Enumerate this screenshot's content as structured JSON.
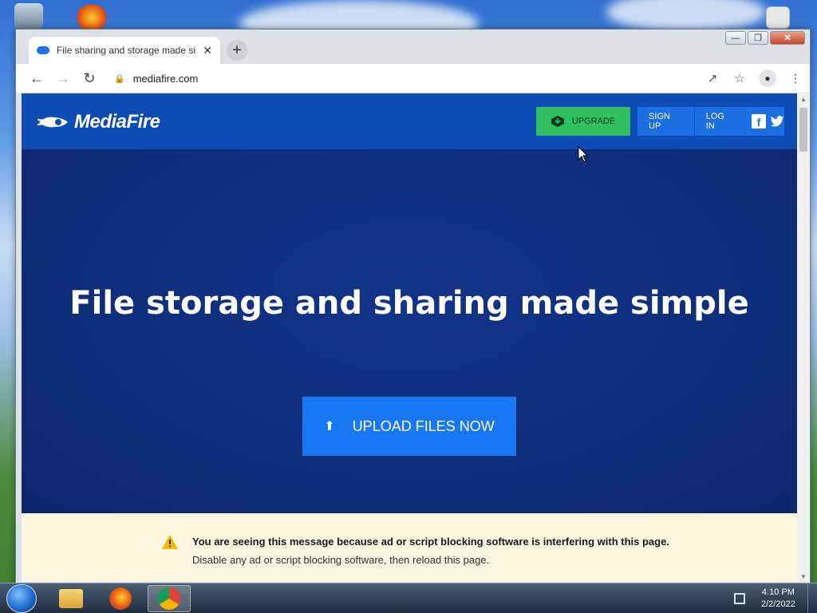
{
  "browser": {
    "tab_title": "File sharing and storage made simple",
    "url": "mediafire.com"
  },
  "header": {
    "logo_text": "MediaFire",
    "upgrade_label": "UPGRADE",
    "signup_label": "SIGN UP",
    "login_label": "LOG IN"
  },
  "hero": {
    "title": "File storage and sharing made simple",
    "upload_label": "UPLOAD FILES NOW"
  },
  "notice": {
    "title": "You are seeing this message because ad or script blocking software is interfering with this page.",
    "text": "Disable any ad or script blocking software, then reload this page."
  },
  "taskbar": {
    "time": "4:10 PM",
    "date": "2/2/2022"
  },
  "colors": {
    "brand_blue": "#0d4bb5",
    "hero_bg": "#0f2f7d",
    "upgrade_green": "#2fc062",
    "upload_blue": "#1877f2"
  }
}
